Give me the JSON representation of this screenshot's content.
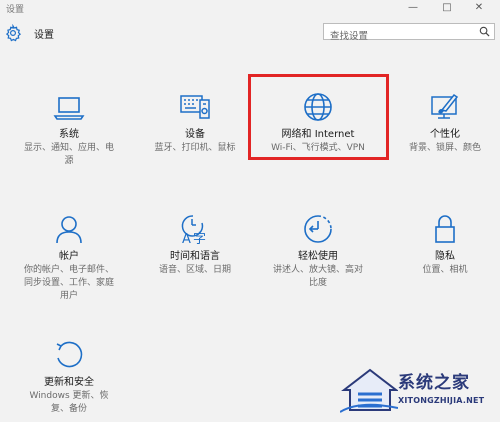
{
  "window": {
    "title": "设置",
    "minimize": "—",
    "maximize": "□",
    "close": "✕"
  },
  "header": {
    "app_title": "设置",
    "search_placeholder": "查找设置"
  },
  "tiles": [
    {
      "name": "系统",
      "desc_lines": [
        "显示、通知、应用、电",
        "源"
      ]
    },
    {
      "name": "设备",
      "desc_lines": [
        "蓝牙、打印机、鼠标"
      ]
    },
    {
      "name": "网络和 Internet",
      "desc_lines": [
        "Wi-Fi、飞行模式、VPN"
      ]
    },
    {
      "name": "个性化",
      "desc_lines": [
        "背景、锁屏、颜色"
      ]
    },
    {
      "name": "帐户",
      "desc_lines": [
        "你的帐户、电子邮件、",
        "同步设置、工作、家庭",
        "用户"
      ]
    },
    {
      "name": "时间和语言",
      "desc_lines": [
        "语音、区域、日期"
      ]
    },
    {
      "name": "轻松使用",
      "desc_lines": [
        "讲述人、放大镜、高对",
        "比度"
      ]
    },
    {
      "name": "隐私",
      "desc_lines": [
        "位置、相机"
      ]
    },
    {
      "name": "更新和安全",
      "desc_lines": [
        "Windows 更新、恢",
        "复、备份"
      ]
    }
  ],
  "watermark": {
    "text": "系统之家",
    "subtext": "XITONGZHIJIA.NET"
  },
  "colors": {
    "accent": "#1e6fc7",
    "highlight": "#e22525"
  }
}
